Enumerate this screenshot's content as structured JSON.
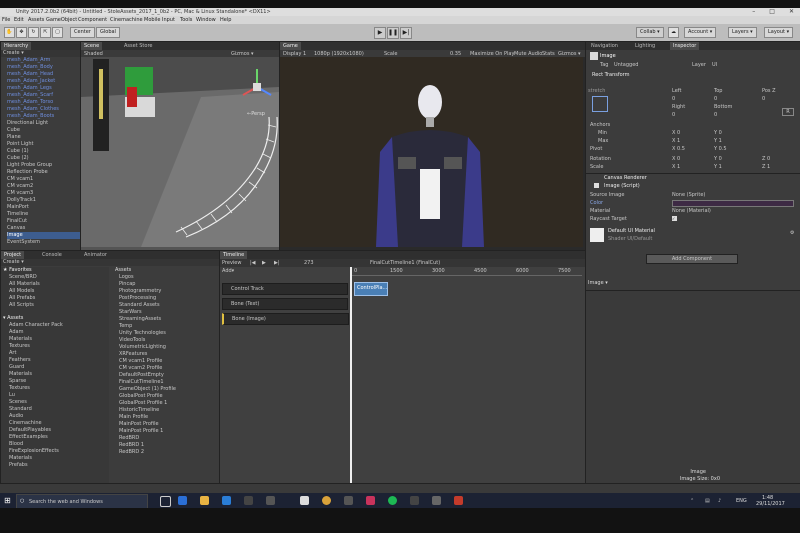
{
  "window": {
    "title": "Unity 2017.2.0b2 (64bit) - Untitled - StoleAssets_2017_1_0b2 - PC, Mac & Linux Standalone* <DX11>"
  },
  "menu": [
    "File",
    "Edit",
    "Assets",
    "GameObject",
    "Component",
    "Cinemachine",
    "Mobile Input",
    "Tools",
    "Window",
    "Help"
  ],
  "toolbar": {
    "center_label": "Center",
    "global_label": "Global",
    "collab_label": "Collab ▾",
    "account_label": "Account ▾",
    "layers_label": "Layers",
    "layout_label": "Layout"
  },
  "hierarchy": {
    "tab": "Hierarchy",
    "create": "Create ▾",
    "items": [
      "mesh_Adam_Arm",
      "mesh_Adam_Body",
      "mesh_Adam_Head",
      "mesh_Adam_Jacket",
      "mesh_Adam_Legs",
      "mesh_Adam_Scarf",
      "mesh_Adam_Torso",
      "mesh_Adam_Clothes",
      "mesh_Adam_Boots",
      "Directional Light",
      "Cube",
      "Plane",
      "Point Light",
      "Cube (1)",
      "Cube (2)",
      "Light Probe Group",
      "Reflection Probe",
      "CM vcam1",
      "CM vcam2",
      "CM vcam3",
      "DollyTrack1",
      "MainPort",
      "Timeline",
      "FinalCut",
      "Canvas",
      "Image",
      "EventSystem"
    ],
    "selected": "Image"
  },
  "scene": {
    "tab": "Scene",
    "store_tab": "Asset Store",
    "shading": "Shaded",
    "gizmos": "Gizmos ▾",
    "persp": "←Persp"
  },
  "game": {
    "tab": "Game",
    "display": "Display 1",
    "resolution": "1080p (1920x1080)",
    "scale": "Scale",
    "scale_value": "0.35",
    "opts": [
      "Maximize On Play",
      "Mute Audio",
      "Stats",
      "Gizmos ▾"
    ]
  },
  "inspector": {
    "tabs": [
      "Navigation",
      "Lighting",
      "Inspector"
    ],
    "object": "Image",
    "tag_label": "Tag",
    "tag": "Untagged",
    "layer_label": "Layer",
    "layer": "UI",
    "rect_header": "Rect Transform",
    "stretch": "stretch",
    "col_labels": [
      "Left",
      "Top",
      "Pos Z"
    ],
    "col_values": [
      "0",
      "0",
      "0"
    ],
    "col_labels2": [
      "Right",
      "Bottom"
    ],
    "col_values2": [
      "0",
      "0"
    ],
    "anchors": "Anchors",
    "min": "Min",
    "max": "Max",
    "pivot": "Pivot",
    "min_x": "X 0",
    "min_y": "Y 0",
    "max_x": "X 1",
    "max_y": "Y 1",
    "pivot_x": "X 0.5",
    "pivot_y": "Y 0.5",
    "rotation": "Rotation",
    "rot_x": "X 0",
    "rot_y": "Y 0",
    "rot_z": "Z 0",
    "scale": "Scale",
    "scale_x": "X 1",
    "scale_y": "Y 1",
    "scale_z": "Z 1",
    "canvas_renderer": "Canvas Renderer",
    "image_script": "Image (Script)",
    "source_image": "Source Image",
    "source_value": "None (Sprite)",
    "color": "Color",
    "material": "Material",
    "material_value": "None (Material)",
    "raycast": "Raycast Target",
    "default_material": "Default UI Material",
    "shader": "Shader  UI/Default",
    "add_component": "Add Component",
    "preview_label": "Image ▾",
    "preview_name": "Image",
    "preview_size": "Image Size: 0x0"
  },
  "project": {
    "tabs": [
      "Project",
      "Console",
      "Animator"
    ],
    "create": "Create ▾",
    "favorites_header": "Favorites",
    "favorites": [
      "Scene/BRD",
      "All Materials",
      "All Models",
      "All Prefabs",
      "All Scripts"
    ],
    "assets_header": "Assets",
    "tree": [
      "Adam Character Pack",
      "Adam",
      "Materials",
      "Textures",
      "Art",
      "Feathers",
      "Guard",
      "Materials",
      "Sparse",
      "Textures",
      "Lu",
      "Scenes",
      "Standard",
      "Audio",
      "Cinemachine",
      "DefaultPlayables",
      "EffectExamples",
      "Blood",
      "FireExplosionEffects",
      "Materials",
      "Prefabs"
    ],
    "assets_title": "Assets",
    "assets": [
      "Logos",
      "Pincap",
      "Photogrammetry",
      "PostProcessing",
      "Standard Assets",
      "StarWars",
      "StreamingAssets",
      "Temp",
      "Unity Technologies",
      "VideoTools",
      "VolumetricLighting",
      "XRFeatures",
      "CM vcam1 Profile",
      "CM vcam2 Profile",
      "DefaultPostEmpty",
      "FinalCutTimeline1",
      "GameObject (1) Profile",
      "GlobalPost Profile",
      "GlobalPost Profile 1",
      "HistoricTimeline",
      "Main Profile",
      "MainPost Profile",
      "MainPost Profile 1",
      "RedBRD",
      "RedBRD 1",
      "RedBRD 2"
    ]
  },
  "timeline": {
    "tab": "Timeline",
    "preview": "Preview",
    "frame": "273",
    "asset": "FinalCutTimeline1 (FinalCut)",
    "add": "Add▾",
    "ticks": [
      "0",
      "1500",
      "3000",
      "4500",
      "6000",
      "7500"
    ],
    "tracks": [
      "Control Track",
      "Bone (Text)",
      "Bone (Image)"
    ],
    "clip": "ControlPla..."
  },
  "taskbar": {
    "search": "Search the web and Windows",
    "lang": "ENG",
    "time": "1:48",
    "date": "29/11/2017"
  },
  "colors": {
    "accent": "#3d5d8f",
    "taskbar": "#1c2233",
    "timeline_clip": "#4a7fb5"
  }
}
